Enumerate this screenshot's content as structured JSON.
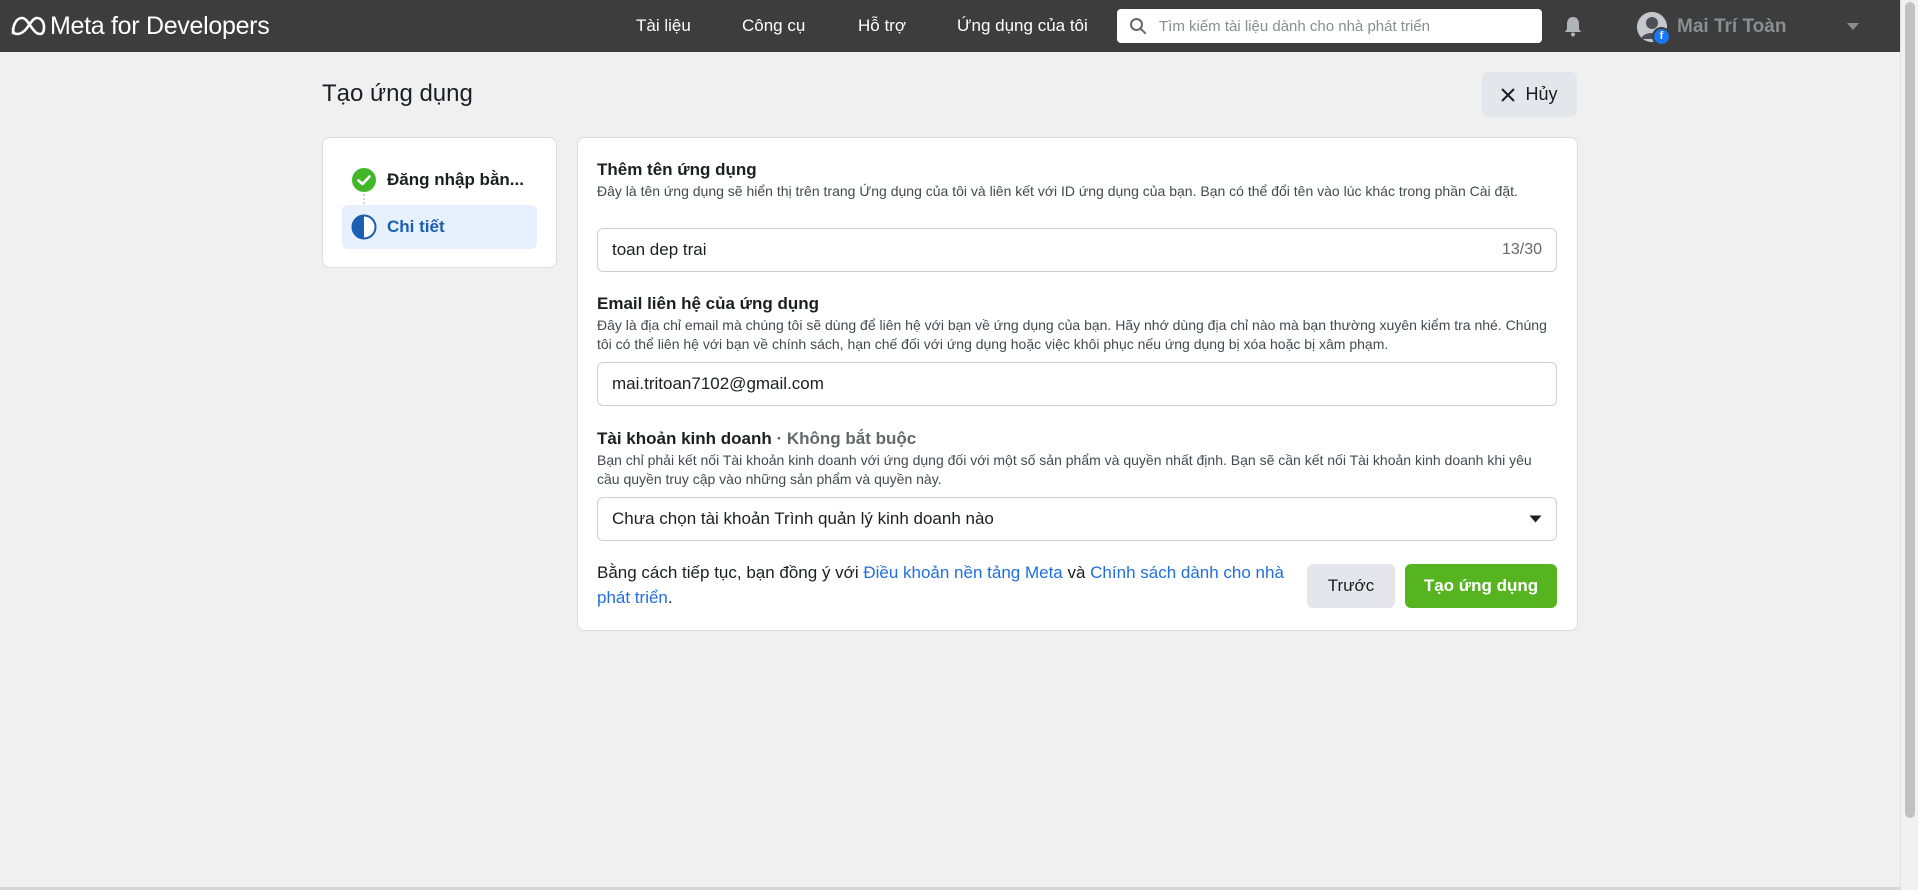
{
  "header": {
    "brand": "Meta for Developers",
    "nav": [
      {
        "label": "Tài liệu"
      },
      {
        "label": "Công cụ"
      },
      {
        "label": "Hỗ trợ"
      },
      {
        "label": "Ứng dụng của tôi"
      }
    ],
    "search": {
      "placeholder": "Tìm kiếm tài liệu dành cho nhà phát triển",
      "value": ""
    },
    "user": {
      "name": "Mai Trí Toàn",
      "badge": "f"
    }
  },
  "page": {
    "title": "Tạo ứng dụng",
    "cancel_label": "Hủy"
  },
  "steps": [
    {
      "label": "Đăng nhập bằn...",
      "status": "complete"
    },
    {
      "label": "Chi tiết",
      "status": "current"
    }
  ],
  "form": {
    "app_name": {
      "label": "Thêm tên ứng dụng",
      "description": "Đây là tên ứng dụng sẽ hiển thị trên trang Ứng dụng của tôi và liên kết với ID ứng dụng của bạn. Bạn có thể đổi tên vào lúc khác trong phần Cài đặt.",
      "value": "toan dep trai",
      "counter": "13/30"
    },
    "email": {
      "label": "Email liên hệ của ứng dụng",
      "description": "Đây là địa chỉ email mà chúng tôi sẽ dùng để liên hệ với bạn về ứng dụng của bạn. Hãy nhớ dùng địa chỉ nào mà bạn thường xuyên kiểm tra nhé. Chúng tôi có thể liên hệ với bạn về chính sách, hạn chế đối với ứng dụng hoặc việc khôi phục nếu ứng dụng bị xóa hoặc bị xâm phạm.",
      "value": "mai.tritoan7102@gmail.com"
    },
    "business": {
      "label": "Tài khoản kinh doanh",
      "optional": " · Không bắt buộc",
      "description": "Bạn chỉ phải kết nối Tài khoản kinh doanh với ứng dụng đối với một số sản phẩm và quyền nhất định. Bạn sẽ cần kết nối Tài khoản kinh doanh khi yêu cầu quyền truy cập vào những sản phẩm và quyền này.",
      "selected": "Chưa chọn tài khoản Trình quản lý kinh doanh nào"
    },
    "terms": {
      "prefix": "Bằng cách tiếp tục, bạn đồng ý với ",
      "link1": "Điều khoản nền tảng Meta",
      "middle": " và ",
      "link2": "Chính sách dành cho nhà phát triển",
      "suffix": "."
    },
    "back_label": "Trước",
    "submit_label": "Tạo ứng dụng"
  },
  "colors": {
    "topbar": "#3d3d3d",
    "primary_green": "#55b41f",
    "link_blue": "#216fdb",
    "step_active_bg": "#e7f0fd",
    "step_complete": "#42b72a"
  },
  "icons": [
    "meta-logo-icon",
    "search-icon",
    "bell-icon",
    "avatar",
    "chevron-down-icon",
    "close-icon",
    "check-circle-icon",
    "half-circle-icon",
    "caret-down-icon"
  ]
}
